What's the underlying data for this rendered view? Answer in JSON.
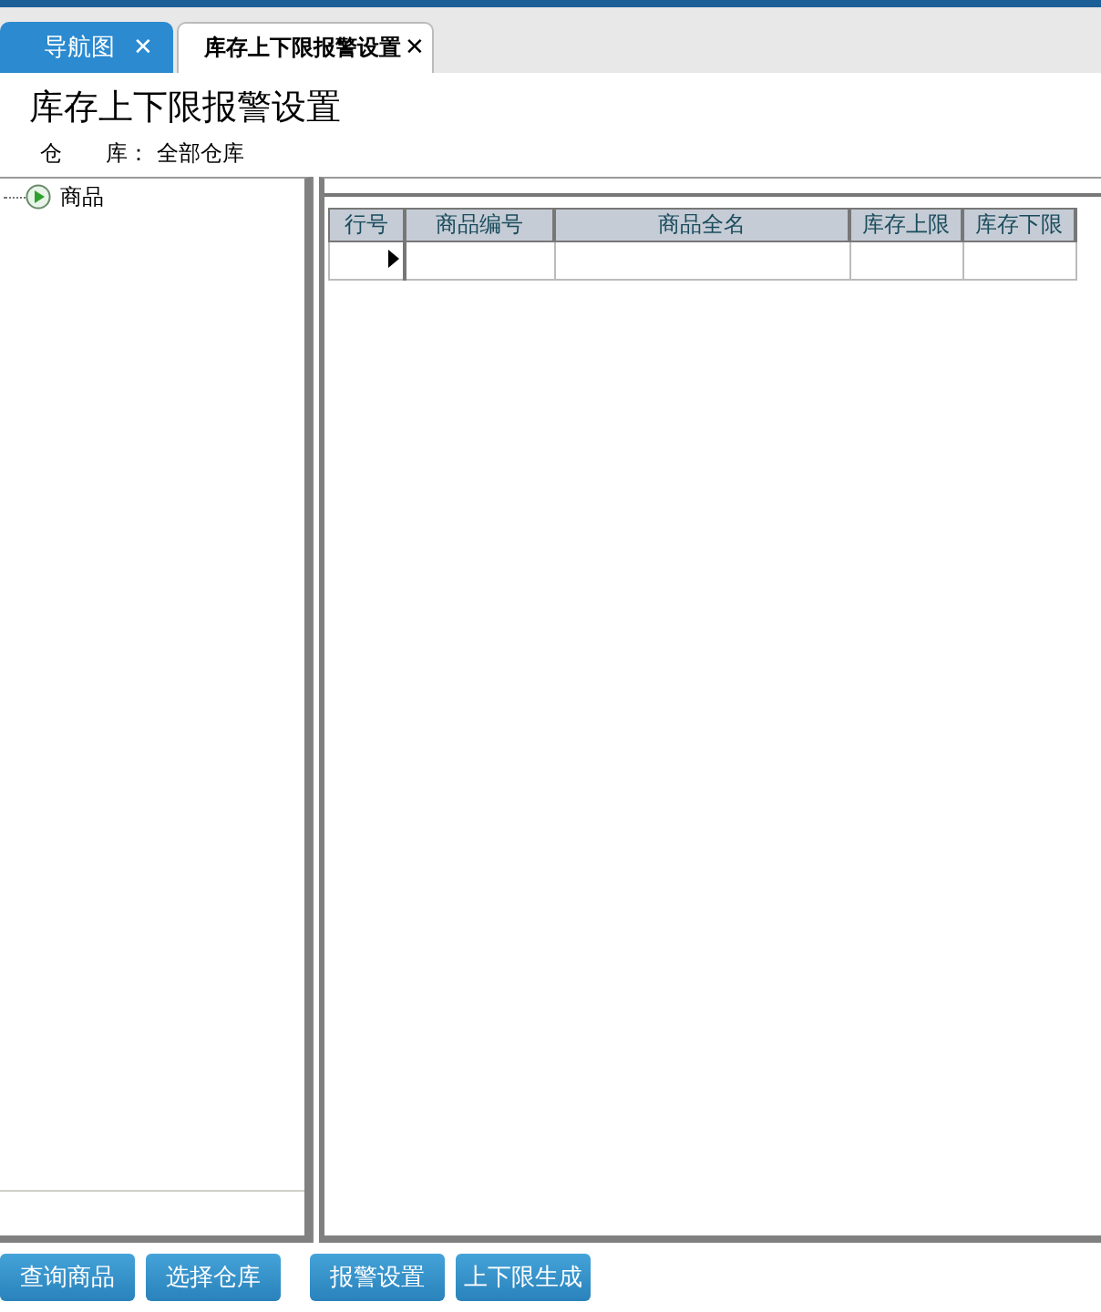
{
  "tabs": [
    {
      "label": "导航图",
      "close": "✕",
      "selected": false
    },
    {
      "label": "库存上下限报警设置",
      "close": "✕",
      "selected": true
    }
  ],
  "title": "库存上下限报警设置",
  "warehouse": {
    "label": "仓　　库：",
    "value": "全部仓库"
  },
  "tree": [
    {
      "label": "商品",
      "expanded": false
    }
  ],
  "table": {
    "columns": [
      "行号",
      "商品编号",
      "商品全名",
      "库存上限",
      "库存下限"
    ],
    "rows": [
      {
        "current": true
      }
    ]
  },
  "buttons": [
    "查询商品",
    "选择仓库",
    "报警设置",
    "上下限生成"
  ]
}
